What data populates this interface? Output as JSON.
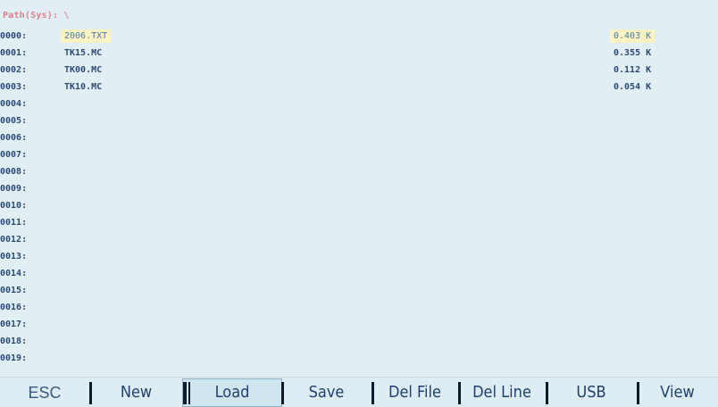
{
  "path": "Path(Sys): \\",
  "files": [
    {
      "index": "0000:",
      "name": "2006.TXT",
      "size": "0.403 K",
      "selected": true
    },
    {
      "index": "0001:",
      "name": "TK15.MC",
      "size": "0.355 K",
      "selected": false
    },
    {
      "index": "0002:",
      "name": "TK00.MC",
      "size": "0.112 K",
      "selected": false
    },
    {
      "index": "0003:",
      "name": "TK10.MC",
      "size": "0.054 K",
      "selected": false
    },
    {
      "index": "0004:",
      "name": "",
      "size": "",
      "selected": false
    },
    {
      "index": "0005:",
      "name": "",
      "size": "",
      "selected": false
    },
    {
      "index": "0006:",
      "name": "",
      "size": "",
      "selected": false
    },
    {
      "index": "0007:",
      "name": "",
      "size": "",
      "selected": false
    },
    {
      "index": "0008:",
      "name": "",
      "size": "",
      "selected": false
    },
    {
      "index": "0009:",
      "name": "",
      "size": "",
      "selected": false
    },
    {
      "index": "0010:",
      "name": "",
      "size": "",
      "selected": false
    },
    {
      "index": "0011:",
      "name": "",
      "size": "",
      "selected": false
    },
    {
      "index": "0012:",
      "name": "",
      "size": "",
      "selected": false
    },
    {
      "index": "0013:",
      "name": "",
      "size": "",
      "selected": false
    },
    {
      "index": "0014:",
      "name": "",
      "size": "",
      "selected": false
    },
    {
      "index": "0015:",
      "name": "",
      "size": "",
      "selected": false
    },
    {
      "index": "0016:",
      "name": "",
      "size": "",
      "selected": false
    },
    {
      "index": "0017:",
      "name": "",
      "size": "",
      "selected": false
    },
    {
      "index": "0018:",
      "name": "",
      "size": "",
      "selected": false
    },
    {
      "index": "0019:",
      "name": "",
      "size": "",
      "selected": false
    }
  ],
  "function_keys": [
    {
      "id": "esc",
      "label": "ESC",
      "active": false
    },
    {
      "id": "new",
      "label": "New",
      "active": false
    },
    {
      "id": "load",
      "label": "Load",
      "active": true
    },
    {
      "id": "save",
      "label": "Save",
      "active": false
    },
    {
      "id": "del-file",
      "label": "Del File",
      "active": false
    },
    {
      "id": "del-line",
      "label": "Del Line",
      "active": false
    },
    {
      "id": "usb",
      "label": "USB",
      "active": false
    },
    {
      "id": "view",
      "label": "View",
      "active": false
    }
  ],
  "colors": {
    "screen_background": "#e1eef4",
    "path_text": "#e07c8e",
    "row_text": "#2a4a78",
    "selection_highlight": "#fbf4c2",
    "selected_text": "#4a7bb0",
    "key_text": "#1f3f6e"
  }
}
